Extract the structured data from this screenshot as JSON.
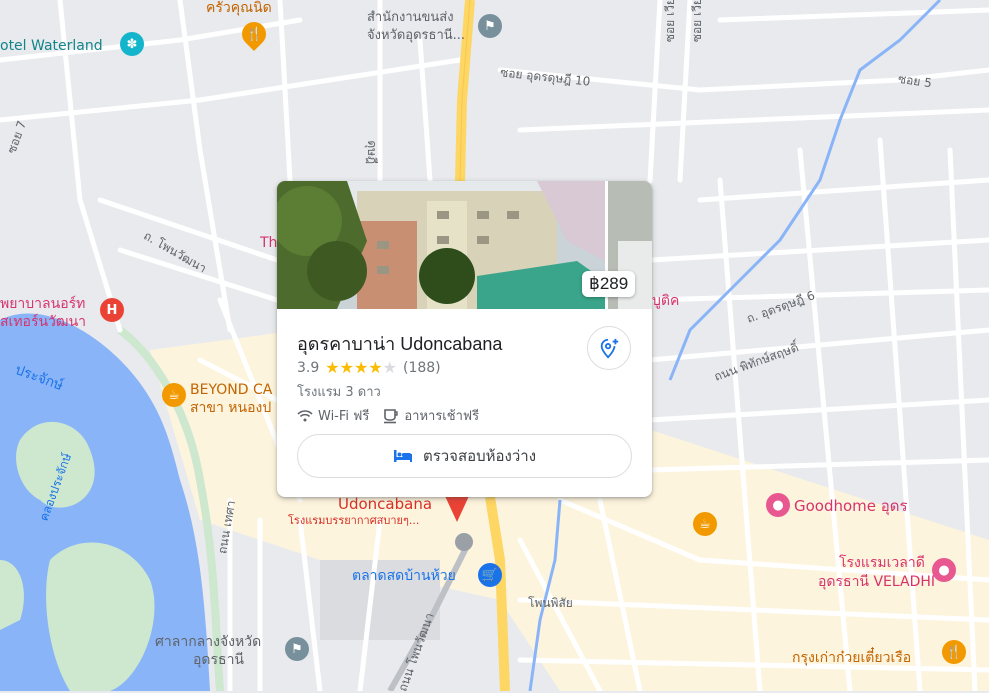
{
  "map": {
    "labels": {
      "hotel_waterland": "otel Waterland",
      "krua_khunnit": "ครัวคุณนิด",
      "local_office_1": "สำนักงานขนส่ง",
      "local_office_2": "จังหวัดอุดรธานี...",
      "soi_udon_10": "ซอย อุดรดุษฎี 10",
      "soi_5": "ซอย 5",
      "soi_v1": "ซอย เวียง",
      "soi_v2": "ซอย เวียง",
      "road_7": "ซอย 7",
      "road_dusadi": "ดุษฎี",
      "road_nonwattana": "ถ. โพนวัฒนา",
      "th_partial": "Th",
      "hospital_1": "พยาบาลนอร์ท",
      "hospital_2": "สเทอร์นวัฒนา",
      "prachak": "ประจักษ์",
      "beyond_1": "BEYOND CA",
      "beyond_2": "สาขา หนองป",
      "soi_udon_6": "ถ. อุดรดุษฎี 6",
      "pithak": "ถนน พิทักษ์สฤษดิ์",
      "buthik": "บูติค",
      "khlong": "คลองประจักษ์",
      "pin_name": "Udoncabana",
      "pin_desc": "โรงแรมบรรยากาศสบายๆ...",
      "goodhome": "Goodhome อุดร",
      "veladhi_1": "โรงแรมเวลาดี",
      "veladhi_2": "อุดรธานี VELADHI",
      "market": "ตลาดสดบ้านห้วย",
      "phoinpisai": "โพนพิสัย",
      "thetsa": "ถนน เทศา",
      "phon_wattana": "ถนน โพนวัฒนา",
      "court_1": "ศาลากลางจังหวัด",
      "court_2": "อุดรธานี",
      "kuay_tiew": "กรุงเก่าก๋วยเตี๋ยวเรือ"
    }
  },
  "card": {
    "price": "฿289",
    "title": "อุดรคาบาน่า Udoncabana",
    "rating": "3.9",
    "stars_filled": 4,
    "review_count": "(188)",
    "hotel_class": "โรงแรม 3 ดาว",
    "amenities": [
      "Wi-Fi ฟรี",
      "อาหารเช้าฟรี"
    ],
    "check_availability": "ตรวจสอบห้องว่าง"
  },
  "colors": {
    "water": "#8ab4f8",
    "park": "#cde8cf",
    "road_major": "#fdd663",
    "accent_blue": "#1a73e8",
    "star": "#fbbc04",
    "pin_red": "#ea4335"
  }
}
